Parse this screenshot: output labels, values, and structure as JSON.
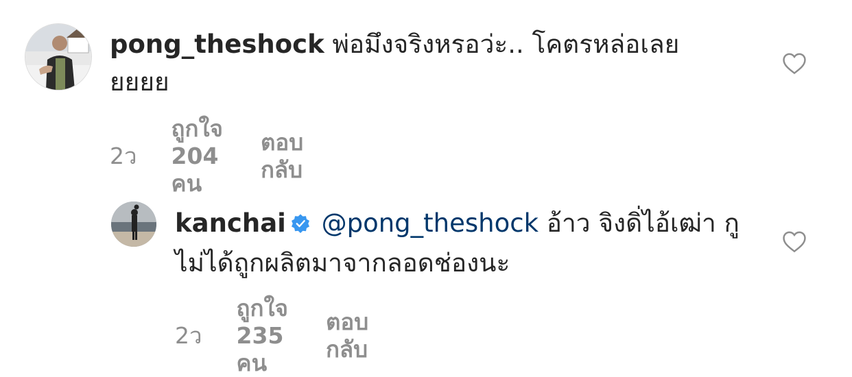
{
  "comments": [
    {
      "username": "pong_theshock",
      "mention": "",
      "text": "พ่อมึงจริงหรอว่ะ.. โคตรหล่อเลยยยยย",
      "time": "2ว",
      "likes": "ถูกใจ 204 คน",
      "reply_label": "ตอบกลับ",
      "verified": false
    },
    {
      "username": "kanchai",
      "mention": "@pong_theshock",
      "text": "อ้าว จิงดิ่ไอ้เฒ่า กูไม่ได้ถูกผลิตมาจากลอดช่องนะ",
      "time": "2ว",
      "likes": "ถูกใจ 235 คน",
      "reply_label": "ตอบกลับ",
      "verified": true
    }
  ],
  "colors": {
    "text": "#262626",
    "secondary": "#8e8e8e",
    "mention": "#00376b",
    "verified": "#3897f0"
  },
  "icons": {
    "like": "heart-outline-icon",
    "verified": "verified-badge-icon"
  }
}
